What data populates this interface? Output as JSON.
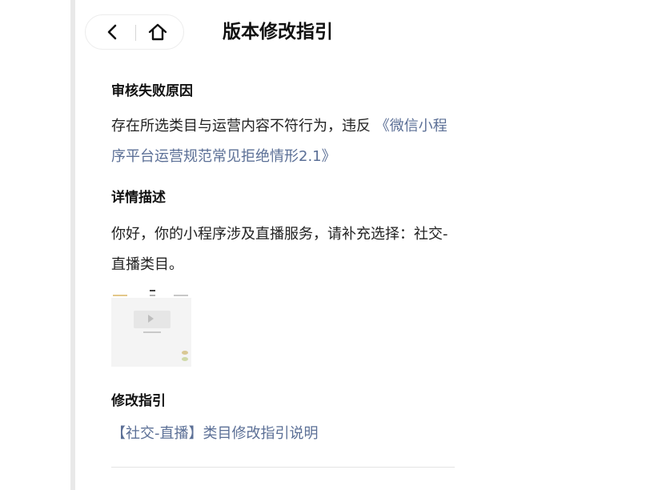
{
  "nav": {
    "title": "版本修改指引",
    "back_icon": "chevron-left-icon",
    "home_icon": "home-icon"
  },
  "sections": {
    "reason": {
      "heading": "审核失败原因",
      "text": "存在所选类目与运营内容不符行为，违反 ",
      "link": "《微信小程序平台运营规范常见拒绝情形2.1》"
    },
    "detail": {
      "heading": "详情描述",
      "text": "你好，你的小程序涉及直播服务，请补充选择：社交-直播类目。"
    },
    "guide": {
      "heading": "修改指引",
      "link": "【社交-直播】类目修改指引说明"
    }
  },
  "colors": {
    "link": "#5b6f96",
    "text": "#222222",
    "divider": "#e4e4e4"
  }
}
